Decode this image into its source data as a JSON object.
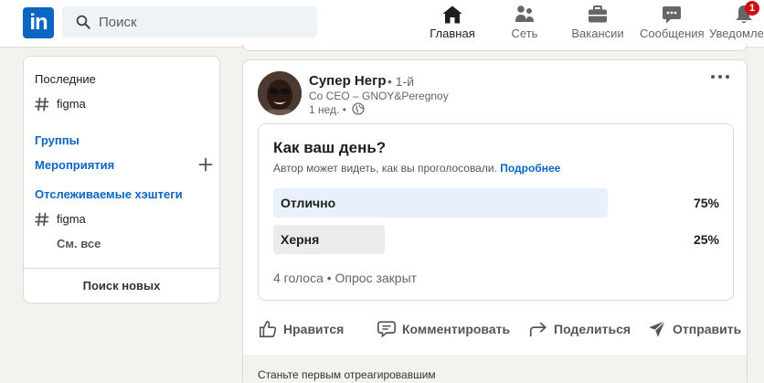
{
  "nav": {
    "logo_text": "in",
    "search_placeholder": "Поиск",
    "items": [
      {
        "label": "Главная",
        "icon": "home-icon",
        "active": true
      },
      {
        "label": "Сеть",
        "icon": "people-icon"
      },
      {
        "label": "Вакансии",
        "icon": "briefcase-icon"
      },
      {
        "label": "Сообщения",
        "icon": "chat-icon"
      },
      {
        "label": "Уведомлен",
        "icon": "bell-icon",
        "badge": "1"
      }
    ]
  },
  "sidebar": {
    "recent_title": "Последние",
    "recent_hashtag": "figma",
    "groups_label": "Группы",
    "events_label": "Мероприятия",
    "followed_title": "Отслеживаемые хэштеги",
    "followed_hashtag": "figma",
    "see_all": "См. все",
    "find_new": "Поиск новых"
  },
  "post": {
    "author_name": "Супер Негр",
    "degree": "• 1-й",
    "headline": "Co CEO – GNOY&Peregnoy",
    "time": "1 нед. •",
    "poll": {
      "question": "Как ваш день?",
      "note": "Автор может видеть, как вы проголосовали.",
      "note_link": "Подробнее",
      "options": [
        {
          "label": "Отлично",
          "percent": "75%",
          "fraction": 0.75,
          "highlight": true
        },
        {
          "label": "Херня",
          "percent": "25%",
          "fraction": 0.25,
          "highlight": false
        }
      ],
      "footer": "4 голоса • Опрос закрыт"
    },
    "actions": [
      {
        "label": "Нравится",
        "icon": "thumbs-up-icon"
      },
      {
        "label": "Комментировать",
        "icon": "comment-icon"
      },
      {
        "label": "Поделиться",
        "icon": "share-icon"
      },
      {
        "label": "Отправить",
        "icon": "send-icon"
      }
    ],
    "react_prompt": "Станьте первым отреагировавшим"
  },
  "colors": {
    "brand": "#0a66c2",
    "badge": "#cc1016",
    "poll_highlight": "#e8f1fb",
    "poll_normal": "#ebebeb"
  }
}
